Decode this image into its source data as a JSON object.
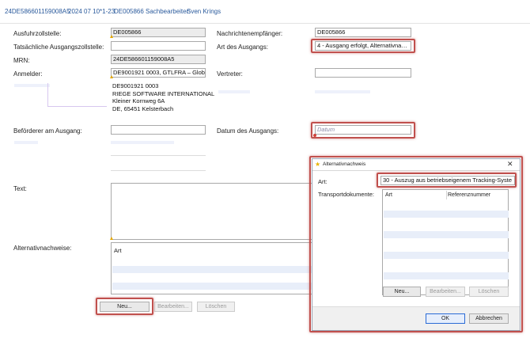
{
  "header": {
    "mrn": "24DE586601159008A5",
    "date_code": "2024 07 10*1-23",
    "id": "DE005866",
    "clerk_label": "Sachbearbeiter:",
    "clerk_name": "Sven Krings"
  },
  "form": {
    "ausfuhrzollstelle_label": "Ausfuhrzollstelle:",
    "ausfuhrzollstelle_value": "DE005866",
    "tats_label": "Tatsächliche Ausgangszollstelle:",
    "tats_value": "",
    "mrn_label": "MRN:",
    "mrn_value": "24DE586601159008A5",
    "anmelder_label": "Anmelder:",
    "anmelder_value": "DE9001921 0003, GTLFRA – Global T",
    "address": [
      "DE9001921 0003",
      "RIEGE SOFTWARE INTERNATIONAL",
      "Kleiner Kornweg 6A",
      "DE, 65451 Kelsterbach"
    ],
    "befoerderer_label": "Beförderer am Ausgang:",
    "befoerderer_value": "",
    "text_label": "Text:",
    "alt_label": "Alternativnachweise:",
    "alt_col": "Art",
    "nachricht_label": "Nachrichtenempfänger:",
    "nachricht_value": "DE005866",
    "art_ausgang_label": "Art des Ausgangs:",
    "art_ausgang_value": "4 - Ausgang erfolgt, Alternativna…",
    "vertreter_label": "Vertreter:",
    "vertreter_value": "",
    "datum_label": "Datum des Ausgangs:",
    "datum_placeholder": "Datum"
  },
  "buttons": {
    "neu": "Neu...",
    "bearbeiten": "Bearbeiten...",
    "loeschen": "Löschen"
  },
  "dialog": {
    "title": "Alternativnachweis",
    "close": "✕",
    "art_label": "Art:",
    "art_value": "30 - Auszug aus betriebseigenem Tracking-Syste",
    "transport_label": "Transportdokumente:",
    "col_art": "Art",
    "col_ref": "Referenznummer",
    "neu": "Neu...",
    "bearbeiten": "Bearbeiten...",
    "loeschen": "Löschen",
    "ok": "OK",
    "abbrechen": "Abbrechen"
  },
  "colors": {
    "link": "#2a5a9c",
    "highlight": "#c0504d",
    "stripe": "#e8eef9",
    "required": "#e6a800"
  }
}
